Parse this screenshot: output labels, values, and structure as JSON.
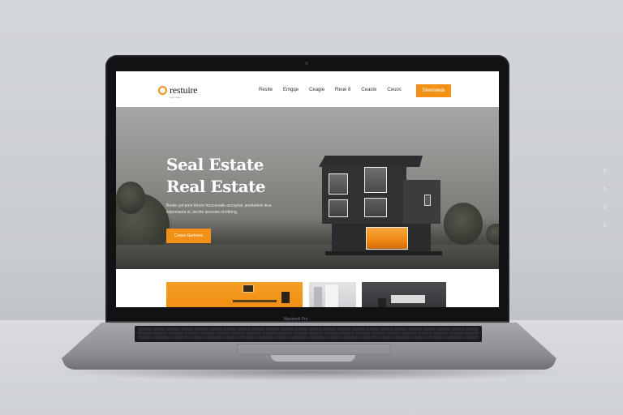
{
  "site": {
    "logo_text": "restuire",
    "logo_tagline": "real estate",
    "nav_links": [
      "Resite",
      "Emgqe",
      "Ceagie",
      "Reue 8",
      "Ceaste",
      "Ceuos"
    ],
    "nav_cta": "Sleesweta",
    "hero": {
      "title_line1": "Seal Estate",
      "title_line2": "Real Estate",
      "description": "Beate yaf pore throre froucenaile aocaytail. jroeitatlvol  ikva siqeonaoia al, tarvhe aioecwe rlnottong,",
      "button_label": "Cnsce Gertsere"
    }
  },
  "laptop": {
    "brand_label": "Macbook Pro"
  },
  "colors": {
    "accent": "#f39117",
    "hero_overlay": "#8f8e8b",
    "screen_bezel": "#111214",
    "laptop_body": "#8a8c90"
  }
}
